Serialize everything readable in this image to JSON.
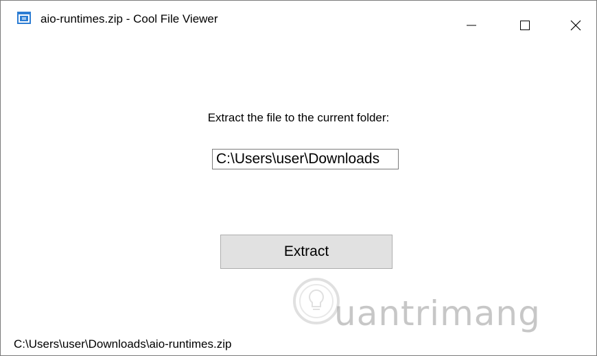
{
  "window": {
    "title": "aio-runtimes.zip - Cool File Viewer",
    "app_icon": "app-window-icon",
    "controls": {
      "minimize_icon": "minimize-icon",
      "maximize_icon": "maximize-icon",
      "close_icon": "close-icon"
    }
  },
  "main": {
    "prompt": "Extract the file to the current folder:",
    "path_value": "C:\\Users\\user\\Downloads",
    "extract_label": "Extract"
  },
  "status": {
    "file_path": "C:\\Users\\user\\Downloads\\aio-runtimes.zip"
  },
  "watermark": {
    "logo_icon": "lightbulb-logo-icon",
    "text": "uantrimang"
  },
  "colors": {
    "app_icon_blue": "#2b7cd3",
    "button_face": "#e1e1e1",
    "button_border": "#adadad",
    "input_border": "#7a7a7a"
  }
}
